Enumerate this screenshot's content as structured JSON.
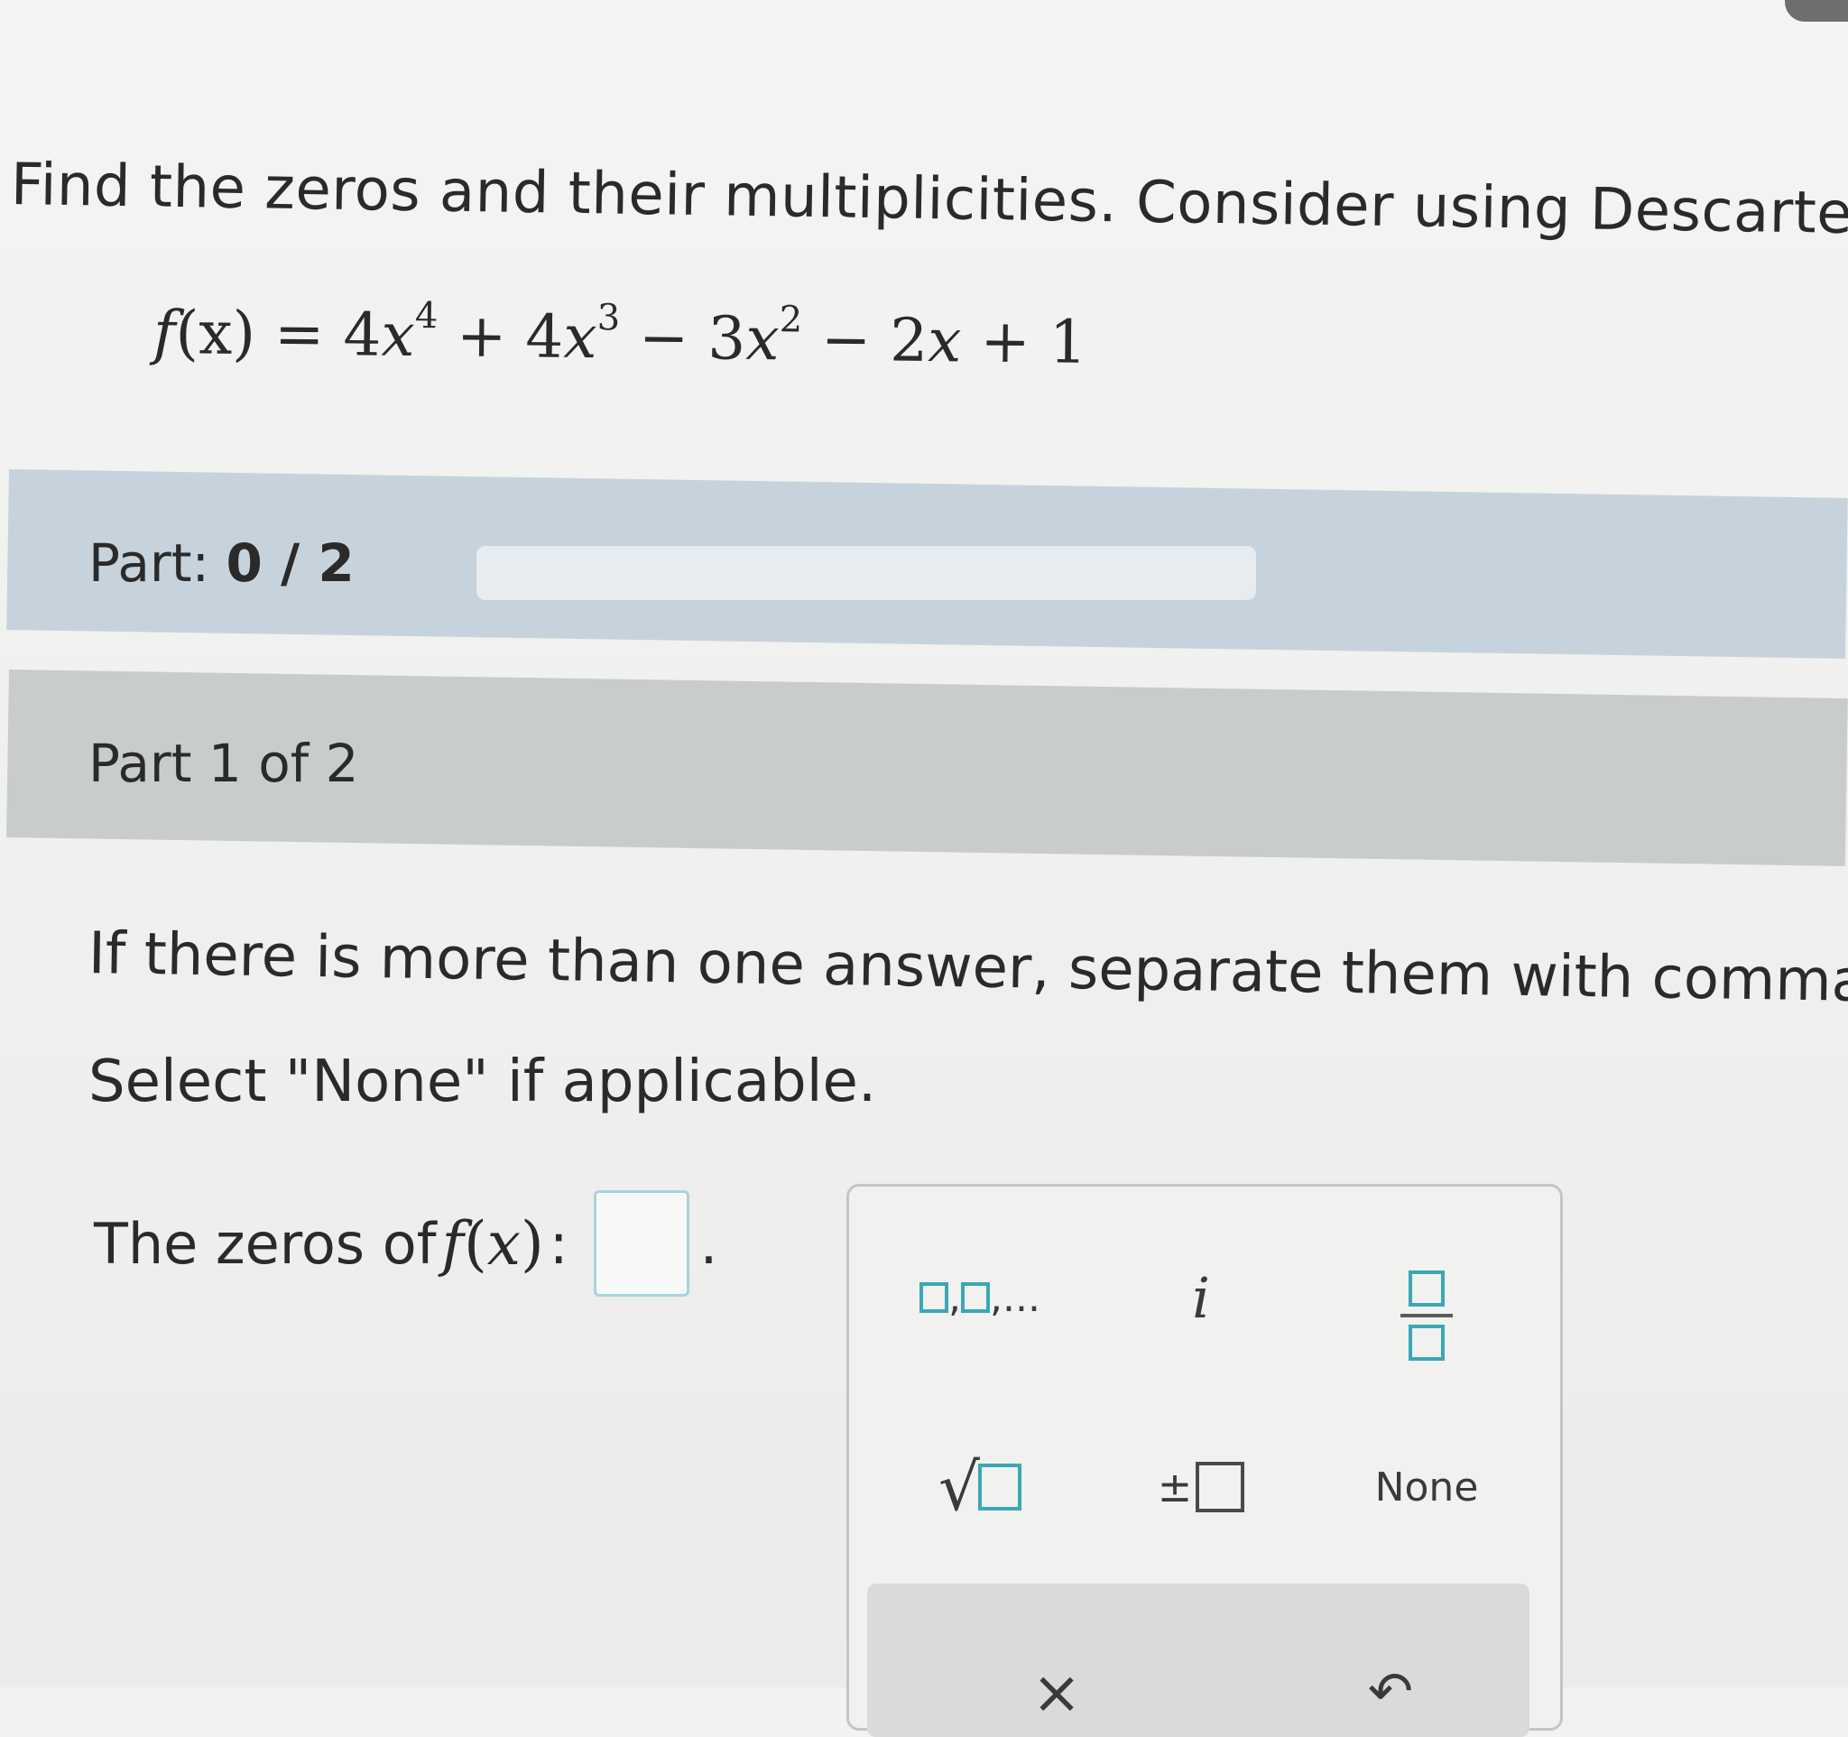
{
  "question": {
    "text": "Find the zeros and their multiplicities. Consider using Descartes' r"
  },
  "equation": {
    "lhs_fn": "f",
    "lhs_var": "(x)",
    "equals": " = ",
    "t1_coef": "4",
    "t1_var": "x",
    "t1_exp": "4",
    "t2_op": " + ",
    "t2_coef": "4",
    "t2_var": "x",
    "t2_exp": "3",
    "t3_op": " − ",
    "t3_coef": "3",
    "t3_var": "x",
    "t3_exp": "2",
    "t4_op": " − ",
    "t4_coef": "2",
    "t4_var": "x",
    "t5_op": " + ",
    "t5_const": "1"
  },
  "progress": {
    "label": "Part: ",
    "completed": "0",
    "separator": " / ",
    "total": "2",
    "fraction": 0
  },
  "part": {
    "label": "Part 1 of 2"
  },
  "instructions": {
    "line1": "If there is more than one answer, separate them with commas.",
    "line2": "Select \"None\" if applicable."
  },
  "answer": {
    "label": "The zeros of ",
    "fn": "f",
    "open": "(",
    "var": "x",
    "close": ")",
    "colon": ":",
    "value": "",
    "period": "."
  },
  "keypad": {
    "list_suffix": ",...",
    "list_comma": ",",
    "imaginary": "i",
    "sqrt_symbol": "√",
    "plus_minus": "±",
    "none_label": "None",
    "clear_symbol": "×",
    "undo_symbol": "↶"
  },
  "colors": {
    "accent": "#3aa7b7",
    "progress_band": "#c7d3dc",
    "part_band": "#c9cdca"
  }
}
